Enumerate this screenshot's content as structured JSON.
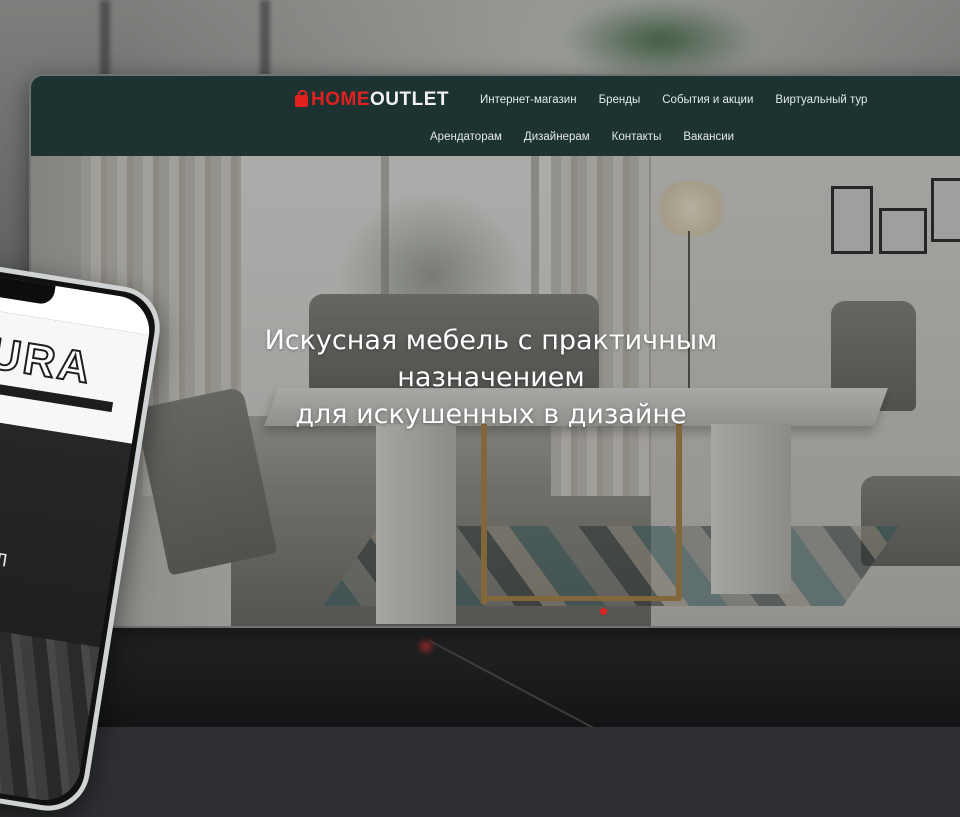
{
  "site": {
    "logo": {
      "home": "HOME",
      "outlet": "OUTLET"
    },
    "nav_primary": [
      "Интернет-магазин",
      "Бренды",
      "События и акции",
      "Виртуальный тур"
    ],
    "nav_secondary": [
      "Арендаторам",
      "Дизайнерам",
      "Контакты",
      "Вакансии"
    ]
  },
  "hero": {
    "title_lines": [
      "Искусная мебель с практичным",
      "назначением",
      "для искушенных в дизайне"
    ]
  },
  "phone": {
    "brand": "URA",
    "hall_label": "ЗАЛ"
  },
  "colors": {
    "accent": "#e0211f",
    "header_bg": "#1c3332"
  }
}
